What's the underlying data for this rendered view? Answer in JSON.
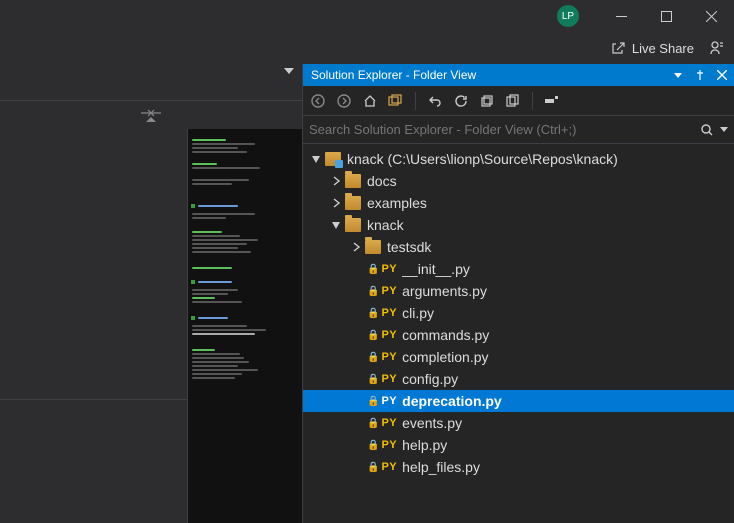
{
  "avatar": "LP",
  "live_share": "Live Share",
  "panel": {
    "title": "Solution Explorer - Folder View",
    "search_placeholder": "Search Solution Explorer - Folder View (Ctrl+;)"
  },
  "tree": {
    "root": {
      "label": "knack (C:\\Users\\lionp\\Source\\Repos\\knack)"
    },
    "docs": "docs",
    "examples": "examples",
    "knack": "knack",
    "testsdk": "testsdk",
    "files": [
      "__init__.py",
      "arguments.py",
      "cli.py",
      "commands.py",
      "completion.py",
      "config.py",
      "deprecation.py",
      "events.py",
      "help.py",
      "help_files.py"
    ],
    "selected": "deprecation.py",
    "py_badge": "PY"
  }
}
